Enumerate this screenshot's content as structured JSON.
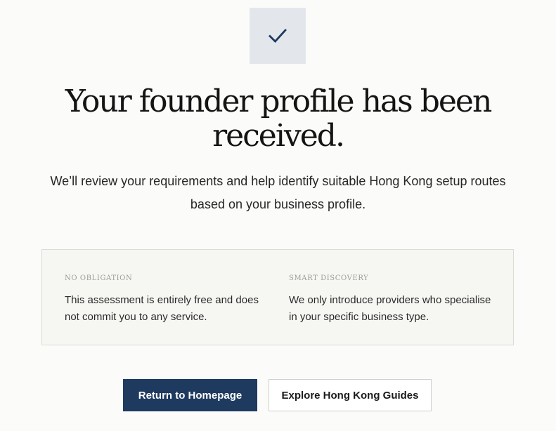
{
  "status_icon": {
    "name": "checkmark-icon",
    "color": "#1f3a5f",
    "background": "#e3e7ec"
  },
  "heading": {
    "line1": "Your founder profile has been",
    "line2": "received."
  },
  "description": "We’ll review your requirements and help identify suitable Hong Kong setup routes based on your business profile.",
  "info": [
    {
      "title": "NO OBLIGATION",
      "text": "This assessment is entirely free and does not commit you to any service."
    },
    {
      "title": "SMART DISCOVERY",
      "text": "We only introduce providers who specialise in your specific business type."
    }
  ],
  "actions": {
    "primary_label": "Return to Homepage",
    "secondary_label": "Explore Hong Kong Guides"
  },
  "colors": {
    "accent": "#1f3a5f",
    "page_background": "#fbfbf9",
    "panel_background": "#f6f7f3"
  }
}
